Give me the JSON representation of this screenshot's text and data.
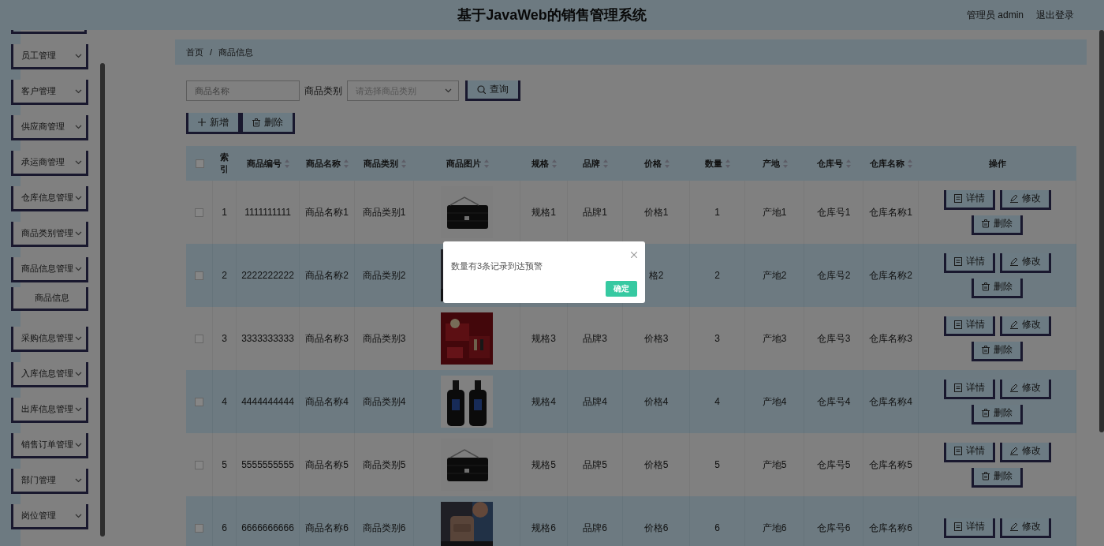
{
  "header": {
    "title": "基于JavaWeb的销售管理系统",
    "user": "管理员 admin",
    "logout": "退出登录"
  },
  "sidebar": {
    "items": [
      {
        "label": "员工管理",
        "kind": "menu"
      },
      {
        "label": "客户管理",
        "kind": "menu"
      },
      {
        "label": "供应商管理",
        "kind": "menu"
      },
      {
        "label": "承运商管理",
        "kind": "menu"
      },
      {
        "label": "仓库信息管理",
        "kind": "menu"
      },
      {
        "label": "商品类别管理",
        "kind": "menu"
      },
      {
        "label": "商品信息管理",
        "kind": "menu"
      },
      {
        "label": "商品信息",
        "kind": "sub"
      },
      {
        "label": "采购信息管理",
        "kind": "menu"
      },
      {
        "label": "入库信息管理",
        "kind": "menu"
      },
      {
        "label": "出库信息管理",
        "kind": "menu"
      },
      {
        "label": "销售订单管理",
        "kind": "menu"
      },
      {
        "label": "部门管理",
        "kind": "menu"
      },
      {
        "label": "岗位管理",
        "kind": "menu"
      }
    ]
  },
  "breadcrumb": {
    "items": [
      "首页",
      "商品信息"
    ],
    "separator": "/"
  },
  "search": {
    "name_placeholder": "商品名称",
    "category_label": "商品类别",
    "category_placeholder": "请选择商品类别",
    "query_button": "查询"
  },
  "toolbar": [
    {
      "label": "新增",
      "kind": "add"
    },
    {
      "label": "删除",
      "kind": "delete"
    }
  ],
  "table": {
    "select_all": {
      "checked": false
    },
    "columns": [
      {
        "label": "索引",
        "sortable": false
      },
      {
        "label": "商品编号",
        "sortable": true
      },
      {
        "label": "商品名称",
        "sortable": true
      },
      {
        "label": "商品类别",
        "sortable": true
      },
      {
        "label": "商品图片",
        "sortable": true
      },
      {
        "label": "规格",
        "sortable": true
      },
      {
        "label": "品牌",
        "sortable": true
      },
      {
        "label": "价格",
        "sortable": true
      },
      {
        "label": "数量",
        "sortable": true
      },
      {
        "label": "产地",
        "sortable": true
      },
      {
        "label": "仓库号",
        "sortable": true
      },
      {
        "label": "仓库名称",
        "sortable": true
      },
      {
        "label": "操作",
        "sortable": false
      }
    ],
    "rows": [
      {
        "checked": false,
        "cells": [
          "1",
          "1111111111",
          "商品名称1",
          "商品类别1",
          {
            "kind": "picture"
          },
          "规格1",
          "品牌1",
          "价格1",
          "1",
          "产地1",
          "仓库号1",
          "仓库名称1"
        ],
        "actions": [
          "详情",
          "修改",
          "删除"
        ]
      },
      {
        "checked": false,
        "cells": [
          "2",
          "2222222222",
          "商品名称2",
          "商品类别2",
          {
            "kind": "picture"
          },
          null,
          null,
          "格2",
          "2",
          "产地2",
          "仓库号2",
          "仓库名称2"
        ],
        "actions": [
          "详情",
          "修改",
          "删除"
        ]
      },
      {
        "checked": false,
        "cells": [
          "3",
          "3333333333",
          "商品名称3",
          "商品类别3",
          {
            "kind": "picture"
          },
          "规格3",
          "品牌3",
          "价格3",
          "3",
          "产地3",
          "仓库号3",
          "仓库名称3"
        ],
        "actions": [
          "详情",
          "修改",
          "删除"
        ]
      },
      {
        "checked": false,
        "cells": [
          "4",
          "4444444444",
          "商品名称4",
          "商品类别4",
          {
            "kind": "picture"
          },
          "规格4",
          "品牌4",
          "价格4",
          "4",
          "产地4",
          "仓库号4",
          "仓库名称4"
        ],
        "actions": [
          "详情",
          "修改",
          "删除"
        ]
      },
      {
        "checked": false,
        "cells": [
          "5",
          "5555555555",
          "商品名称5",
          "商品类别5",
          {
            "kind": "picture"
          },
          "规格5",
          "品牌5",
          "价格5",
          "5",
          "产地5",
          "仓库号5",
          "仓库名称5"
        ],
        "actions": [
          "详情",
          "修改",
          "删除"
        ]
      },
      {
        "checked": false,
        "cells": [
          "6",
          "6666666666",
          "商品名称6",
          "商品类别6",
          {
            "kind": "picture"
          },
          "规格6",
          "品牌6",
          "价格6",
          "6",
          "产地6",
          "仓库号6",
          "仓库名称6"
        ],
        "actions": [
          "详情",
          "修改"
        ]
      }
    ]
  },
  "dialog": {
    "message": "数量有3条记录到达预警",
    "confirm": "确定"
  }
}
